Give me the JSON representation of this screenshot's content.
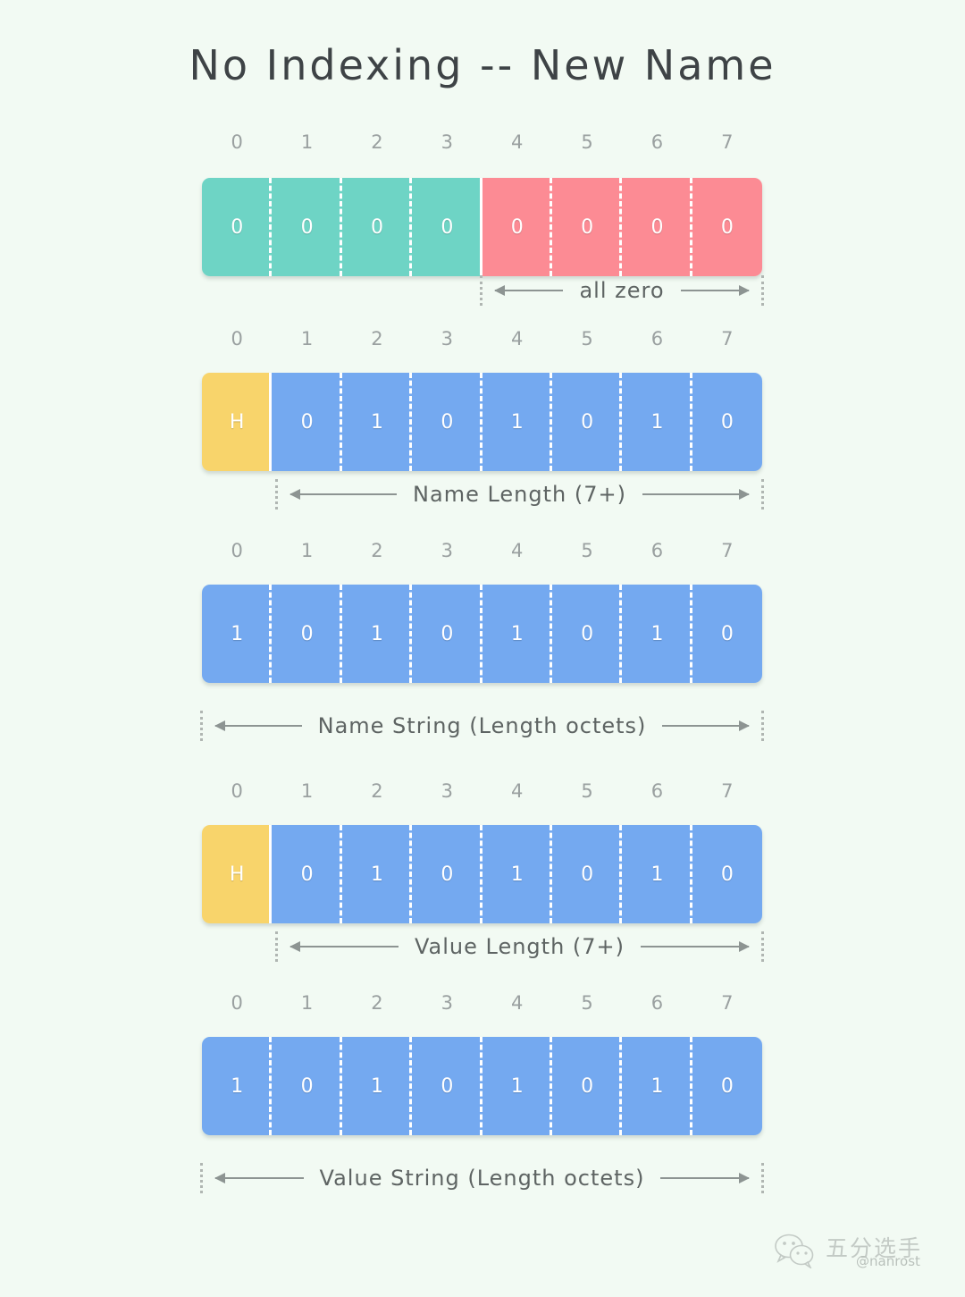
{
  "title": "No Indexing -- New Name",
  "bit_ruler": [
    "0",
    "1",
    "2",
    "3",
    "4",
    "5",
    "6",
    "7"
  ],
  "colors": {
    "background": "#f2faf3",
    "teal": "#6ed4c5",
    "pink": "#fc8b94",
    "blue": "#74a9f0",
    "yellow": "#f8d46b",
    "title_text": "#3e4346",
    "ruler_text": "#9aa0a0",
    "caption_text": "#5e6463",
    "arrow": "#8d9492",
    "cell_text": "#ffffff"
  },
  "rows": [
    {
      "name": "prefix-octet",
      "ruler": [
        "0",
        "1",
        "2",
        "3",
        "4",
        "5",
        "6",
        "7"
      ],
      "cells": [
        {
          "label": "0",
          "color": "teal"
        },
        {
          "label": "0",
          "color": "teal"
        },
        {
          "label": "0",
          "color": "teal"
        },
        {
          "label": "0",
          "color": "teal"
        },
        {
          "label": "0",
          "color": "pink"
        },
        {
          "label": "0",
          "color": "pink"
        },
        {
          "label": "0",
          "color": "pink"
        },
        {
          "label": "0",
          "color": "pink"
        }
      ],
      "caption": "all zero"
    },
    {
      "name": "name-length-octet",
      "ruler": [
        "0",
        "1",
        "2",
        "3",
        "4",
        "5",
        "6",
        "7"
      ],
      "cells": [
        {
          "label": "H",
          "color": "yellow"
        },
        {
          "label": "0",
          "color": "blue"
        },
        {
          "label": "1",
          "color": "blue"
        },
        {
          "label": "0",
          "color": "blue"
        },
        {
          "label": "1",
          "color": "blue"
        },
        {
          "label": "0",
          "color": "blue"
        },
        {
          "label": "1",
          "color": "blue"
        },
        {
          "label": "0",
          "color": "blue"
        }
      ],
      "caption": "Name Length (7+)"
    },
    {
      "name": "name-string-octet",
      "ruler": [
        "0",
        "1",
        "2",
        "3",
        "4",
        "5",
        "6",
        "7"
      ],
      "cells": [
        {
          "label": "1",
          "color": "blue"
        },
        {
          "label": "0",
          "color": "blue"
        },
        {
          "label": "1",
          "color": "blue"
        },
        {
          "label": "0",
          "color": "blue"
        },
        {
          "label": "1",
          "color": "blue"
        },
        {
          "label": "0",
          "color": "blue"
        },
        {
          "label": "1",
          "color": "blue"
        },
        {
          "label": "0",
          "color": "blue"
        }
      ],
      "caption": "Name String (Length octets)"
    },
    {
      "name": "value-length-octet",
      "ruler": [
        "0",
        "1",
        "2",
        "3",
        "4",
        "5",
        "6",
        "7"
      ],
      "cells": [
        {
          "label": "H",
          "color": "yellow"
        },
        {
          "label": "0",
          "color": "blue"
        },
        {
          "label": "1",
          "color": "blue"
        },
        {
          "label": "0",
          "color": "blue"
        },
        {
          "label": "1",
          "color": "blue"
        },
        {
          "label": "0",
          "color": "blue"
        },
        {
          "label": "1",
          "color": "blue"
        },
        {
          "label": "0",
          "color": "blue"
        }
      ],
      "caption": "Value Length (7+)"
    },
    {
      "name": "value-string-octet",
      "ruler": [
        "0",
        "1",
        "2",
        "3",
        "4",
        "5",
        "6",
        "7"
      ],
      "cells": [
        {
          "label": "1",
          "color": "blue"
        },
        {
          "label": "0",
          "color": "blue"
        },
        {
          "label": "1",
          "color": "blue"
        },
        {
          "label": "0",
          "color": "blue"
        },
        {
          "label": "1",
          "color": "blue"
        },
        {
          "label": "0",
          "color": "blue"
        },
        {
          "label": "1",
          "color": "blue"
        },
        {
          "label": "0",
          "color": "blue"
        }
      ],
      "caption": "Value String (Length octets)"
    }
  ],
  "watermark": {
    "icon": "wechat-icon",
    "name": "五分选手",
    "handle": "@nanrost"
  }
}
